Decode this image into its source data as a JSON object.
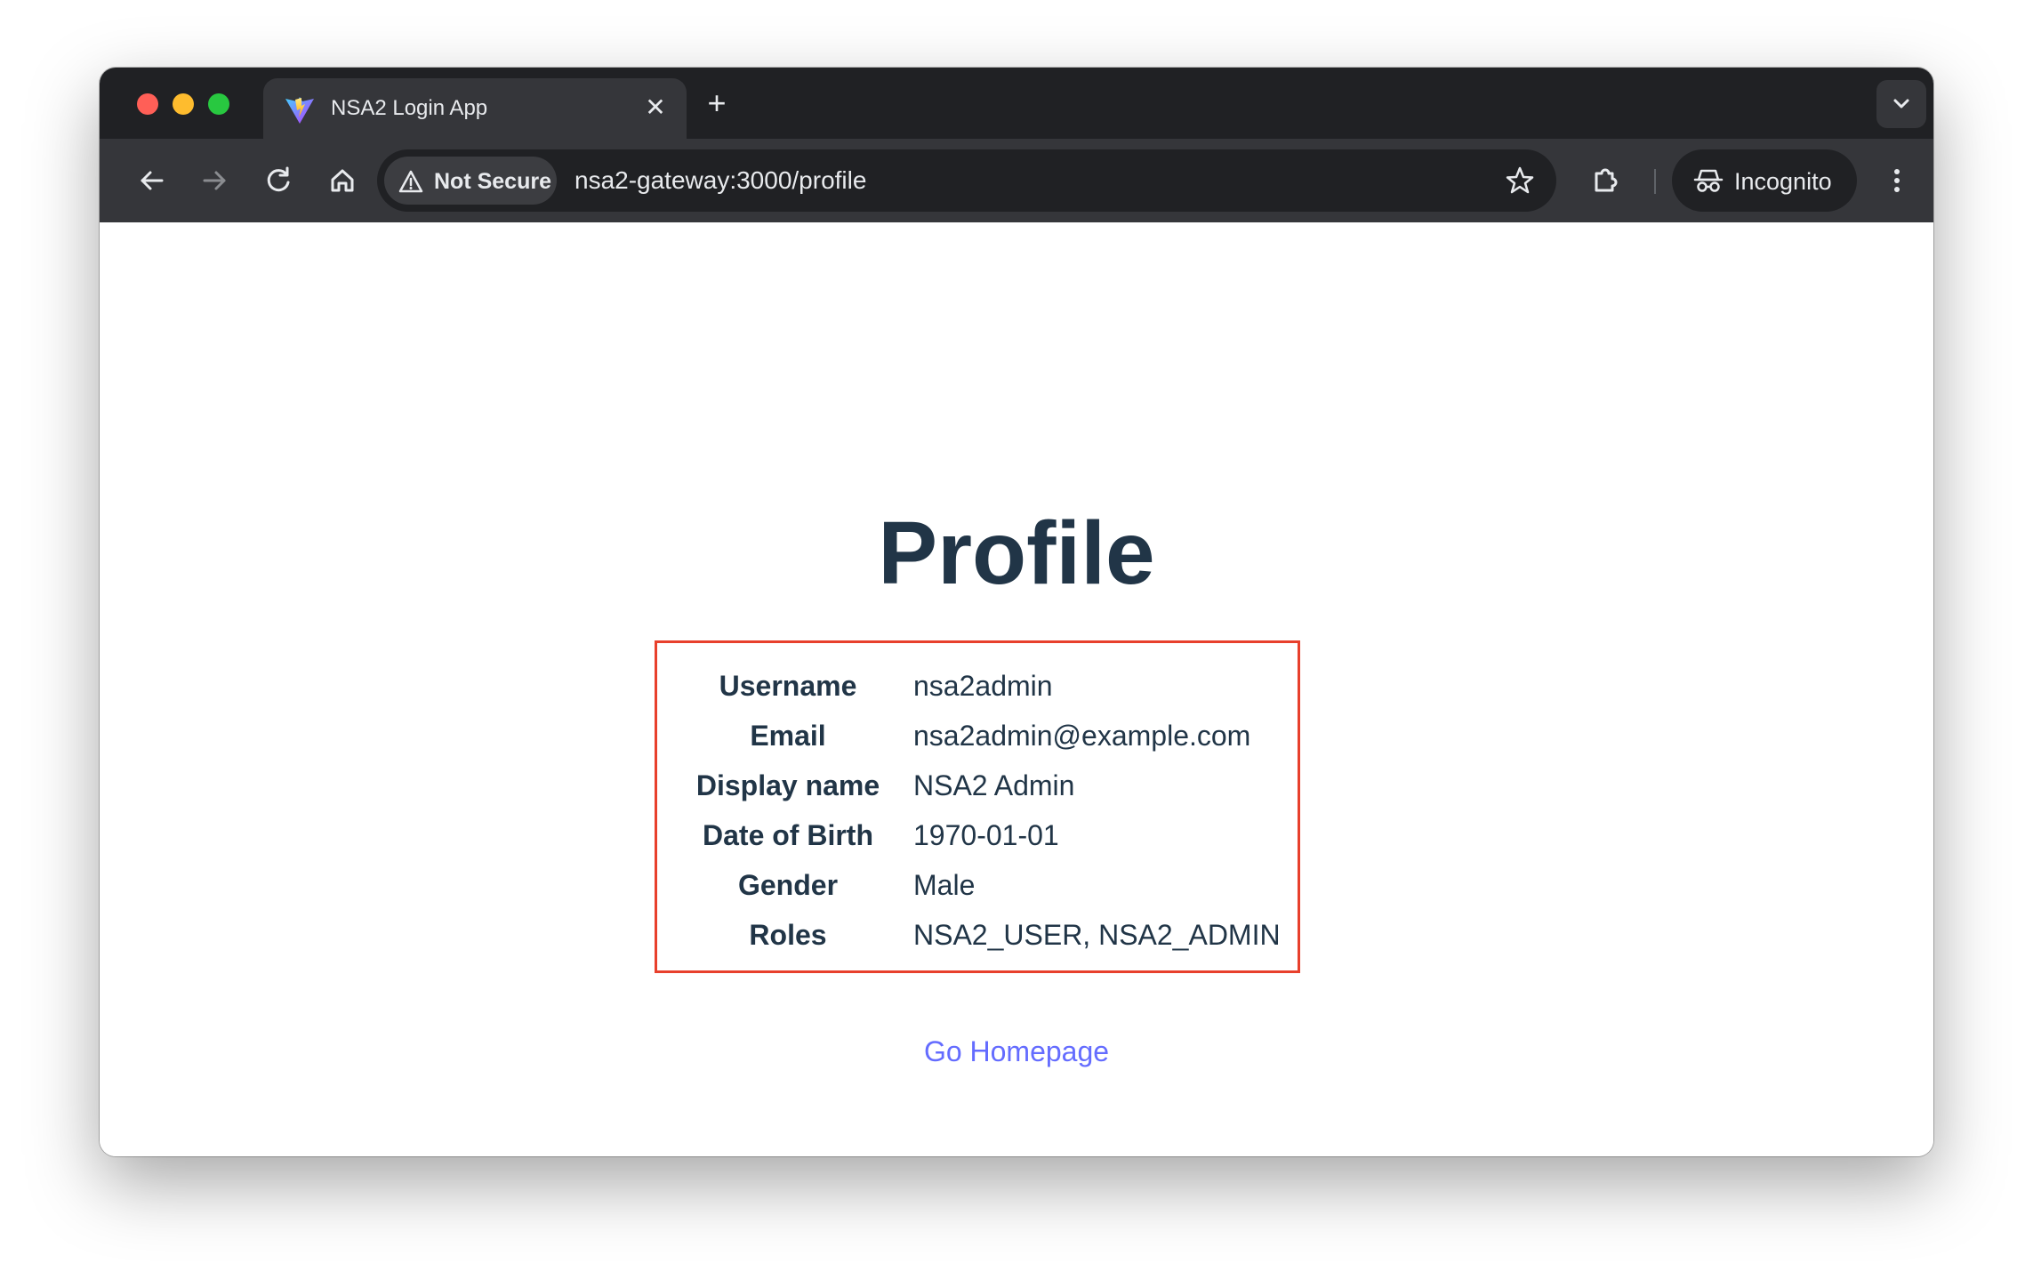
{
  "browser": {
    "tab": {
      "title": "NSA2 Login App",
      "close_glyph": "✕"
    },
    "new_tab_glyph": "+",
    "address_bar": {
      "security_label": "Not Secure",
      "url": "nsa2-gateway:3000/profile"
    },
    "profile_chip_label": "Incognito",
    "icons": [
      "back-icon",
      "forward-icon",
      "reload-icon",
      "home-icon",
      "warning-icon",
      "star-icon",
      "extensions-icon",
      "incognito-icon",
      "more-menu-icon",
      "tab-search-icon",
      "vite-favicon"
    ]
  },
  "page": {
    "title": "Profile",
    "profile": {
      "rows": [
        {
          "label": "Username",
          "value": "nsa2admin"
        },
        {
          "label": "Email",
          "value": "nsa2admin@example.com"
        },
        {
          "label": "Display name",
          "value": "NSA2 Admin"
        },
        {
          "label": "Date of Birth",
          "value": "1970-01-01"
        },
        {
          "label": "Gender",
          "value": "Male"
        },
        {
          "label": "Roles",
          "value": "NSA2_USER, NSA2_ADMIN"
        }
      ]
    },
    "home_link_label": "Go Homepage"
  },
  "colors": {
    "title_text": "#213547",
    "box_border": "#e8402c",
    "link": "#646cff",
    "chrome_dark": "#202124",
    "chrome_toolbar": "#35363a"
  }
}
